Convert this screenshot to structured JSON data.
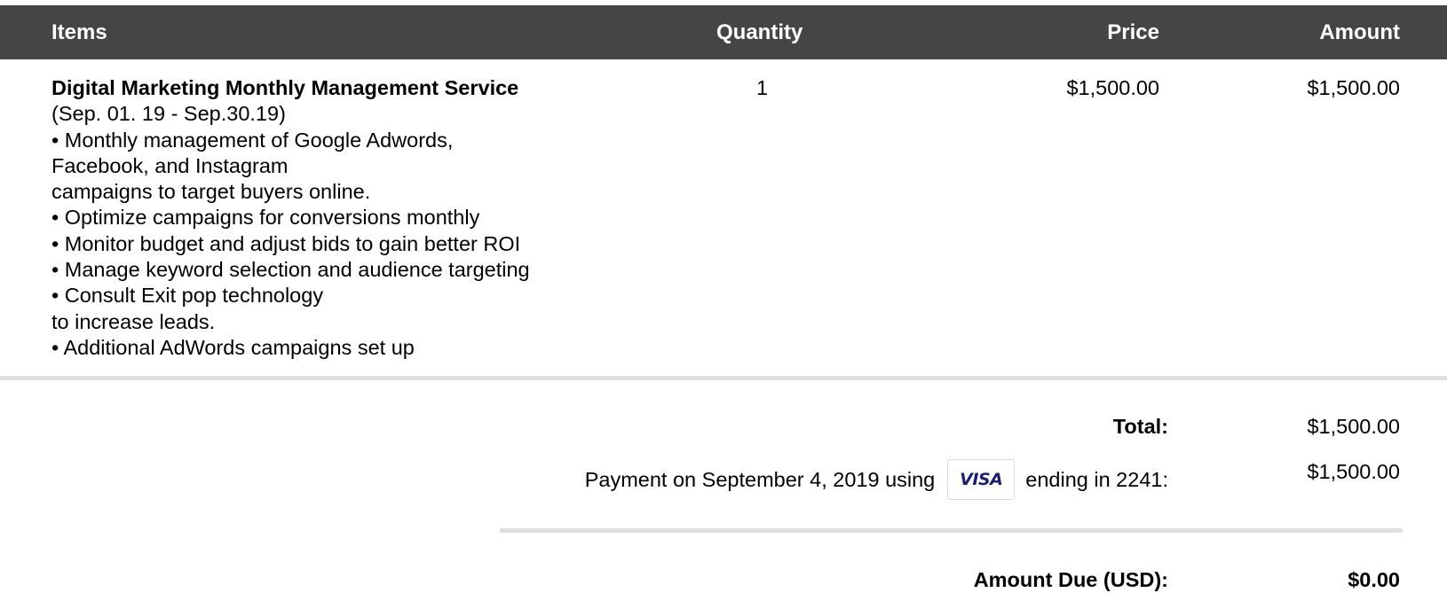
{
  "table": {
    "headers": {
      "items": "Items",
      "quantity": "Quantity",
      "price": "Price",
      "amount": "Amount"
    },
    "rows": [
      {
        "name": "Digital Marketing Monthly Management Service",
        "description_lines": [
          "(Sep. 01. 19 -  Sep.30.19)",
          "• Monthly management of Google Adwords,",
          "Facebook, and Instagram",
          "campaigns to target buyers online.",
          "• Optimize campaigns for conversions monthly",
          "• Monitor budget and adjust bids to gain better ROI",
          "• Manage keyword selection and audience targeting",
          "• Consult Exit pop technology",
          "to increase leads.",
          "• Additional AdWords campaigns set up"
        ],
        "quantity": "1",
        "price": "$1,500.00",
        "amount": "$1,500.00"
      }
    ]
  },
  "summary": {
    "total_label": "Total:",
    "total_value": "$1,500.00",
    "payment_prefix": "Payment on September 4, 2019 using",
    "card_brand": "VISA",
    "card_brand_color": "#1a1f71",
    "payment_suffix": "ending in 2241:",
    "payment_value": "$1,500.00",
    "amount_due_label": "Amount Due (USD):",
    "amount_due_value": "$0.00"
  },
  "colors": {
    "header_bg": "#454545",
    "divider": "#dde0df"
  }
}
